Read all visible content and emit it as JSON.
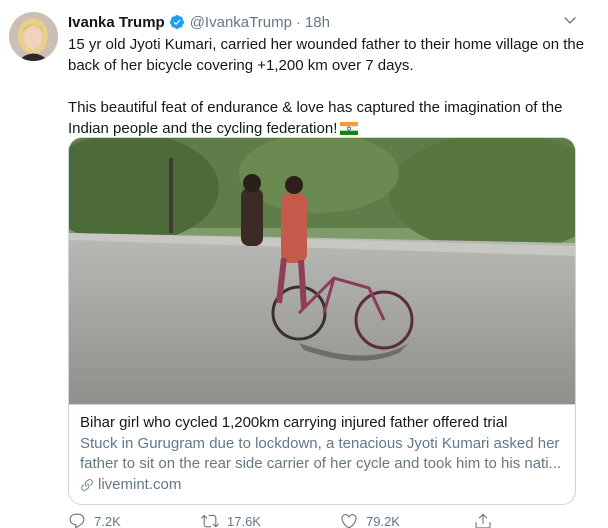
{
  "tweet": {
    "author_name": "Ivanka Trump",
    "author_handle": "@IvankaTrump",
    "separator": "·",
    "time": "18h",
    "text_line1": "15 yr old Jyoti Kumari, carried her wounded father to their home village on the back of her bicycle covering +1,200 km over 7 days.",
    "text_line2": "This beautiful feat of endurance & love has captured the imagination of the Indian people and the cycling federation!",
    "flag_icon": "india-flag-emoji"
  },
  "card": {
    "title": "Bihar girl who cycled 1,200km carrying injured father offered trial",
    "description_line1": "Stuck in Gurugram due to lockdown, a tenacious Jyoti Kumari asked her",
    "description_line2": "father to sit on the rear side carrier of her cycle and took him to his nati...",
    "domain": "livemint.com"
  },
  "actions": {
    "reply_count": "7.2K",
    "retweet_count": "17.6K",
    "like_count": "79.2K"
  },
  "colors": {
    "text": "#14171a",
    "secondary": "#657786",
    "verified": "#1da1f2",
    "border": "#ccd6dd"
  }
}
